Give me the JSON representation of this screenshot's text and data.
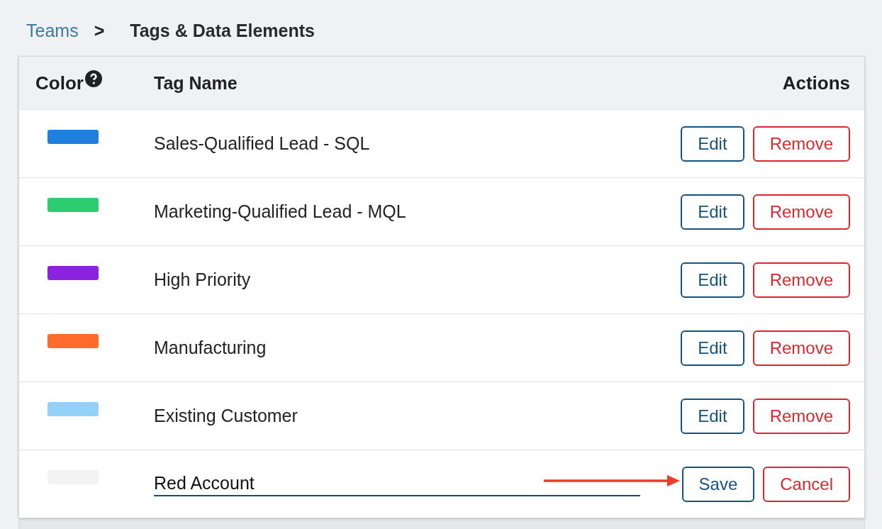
{
  "breadcrumb": {
    "parent": "Teams",
    "separator": ">",
    "current": "Tags & Data Elements"
  },
  "table": {
    "columns": [
      {
        "label": "Color",
        "help": true
      },
      {
        "label": "Tag Name"
      },
      {
        "label": "Actions"
      }
    ],
    "rows": [
      {
        "kind": "view",
        "color": "#1e7fdc",
        "name": "Sales-Qualified Lead - SQL",
        "buttons": [
          {
            "label": "Edit",
            "kind": "primary"
          },
          {
            "label": "Remove",
            "kind": "danger"
          }
        ]
      },
      {
        "kind": "view",
        "color": "#2ecc71",
        "name": "Marketing-Qualified Lead - MQL",
        "buttons": [
          {
            "label": "Edit",
            "kind": "primary"
          },
          {
            "label": "Remove",
            "kind": "danger"
          }
        ]
      },
      {
        "kind": "view",
        "color": "#8a22e0",
        "name": "High Priority",
        "buttons": [
          {
            "label": "Edit",
            "kind": "primary"
          },
          {
            "label": "Remove",
            "kind": "danger"
          }
        ]
      },
      {
        "kind": "view",
        "color": "#ff6b2b",
        "name": "Manufacturing",
        "buttons": [
          {
            "label": "Edit",
            "kind": "primary"
          },
          {
            "label": "Remove",
            "kind": "danger"
          }
        ]
      },
      {
        "kind": "view",
        "color": "#93d1f8",
        "name": "Existing Customer",
        "buttons": [
          {
            "label": "Edit",
            "kind": "primary"
          },
          {
            "label": "Remove",
            "kind": "danger"
          }
        ]
      },
      {
        "kind": "edit",
        "color": "#f3f3f3",
        "name": "Red Account",
        "buttons": [
          {
            "label": "Save",
            "kind": "primary"
          },
          {
            "label": "Cancel",
            "kind": "danger"
          }
        ]
      }
    ]
  }
}
